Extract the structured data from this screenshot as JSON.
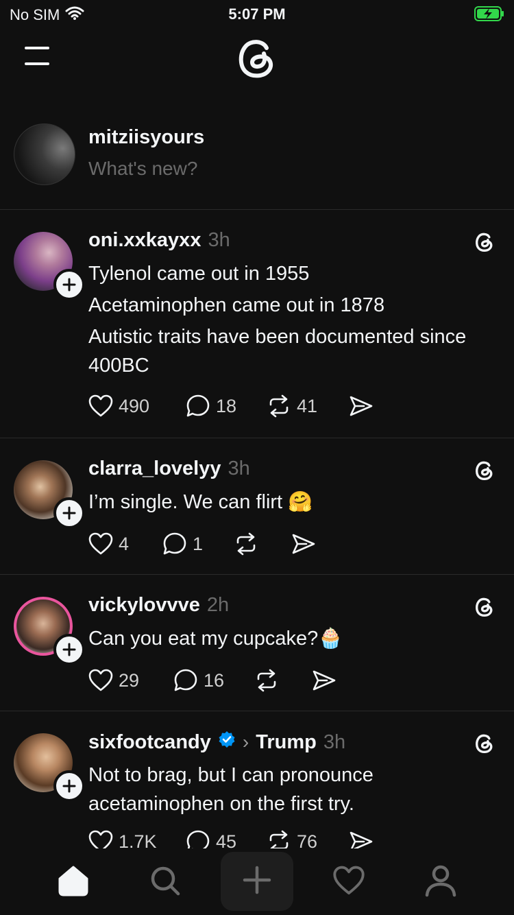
{
  "status": {
    "carrier": "No SIM",
    "time": "5:07 PM",
    "wifi_icon": "wifi-icon",
    "battery_icon": "battery-charging-icon",
    "battery_color": "#32d74b"
  },
  "topbar": {
    "menu_icon": "hamburger-menu-icon",
    "logo_icon": "threads-logo-icon"
  },
  "composer": {
    "username": "mitziisyours",
    "placeholder": "What's new?"
  },
  "posts": [
    {
      "username": "oni.xxkayxx",
      "time": "3h",
      "lines": [
        "Tylenol came out in 1955",
        "Acetaminophen came out in 1878",
        "Autistic traits have been documented since 400BC"
      ],
      "likes": "490",
      "replies": "18",
      "reposts": "41"
    },
    {
      "username": "clarra_lovelyy",
      "time": "3h",
      "lines": [
        "I’m single. We can flirt 🤗"
      ],
      "likes": "4",
      "replies": "1",
      "reposts": ""
    },
    {
      "username": "vickylovvve",
      "time": "2h",
      "lines": [
        "Can you eat my cupcake?🧁"
      ],
      "likes": "29",
      "replies": "16",
      "reposts": ""
    },
    {
      "username": "sixfootcandy",
      "verified": true,
      "community": "Trump",
      "time": "3h",
      "lines": [
        "Not to brag, but I can pronounce acetaminophen on the first try."
      ],
      "likes": "1.7K",
      "replies": "45",
      "reposts": "76"
    }
  ],
  "tabbar": {
    "items": [
      "home-icon",
      "search-icon",
      "plus-icon",
      "heart-icon",
      "profile-icon"
    ]
  },
  "colors": {
    "background": "#101010",
    "text": "#f3f5f7",
    "muted": "#6b6b6b",
    "verified": "#0095f6",
    "story_ring": "#e9559d"
  }
}
